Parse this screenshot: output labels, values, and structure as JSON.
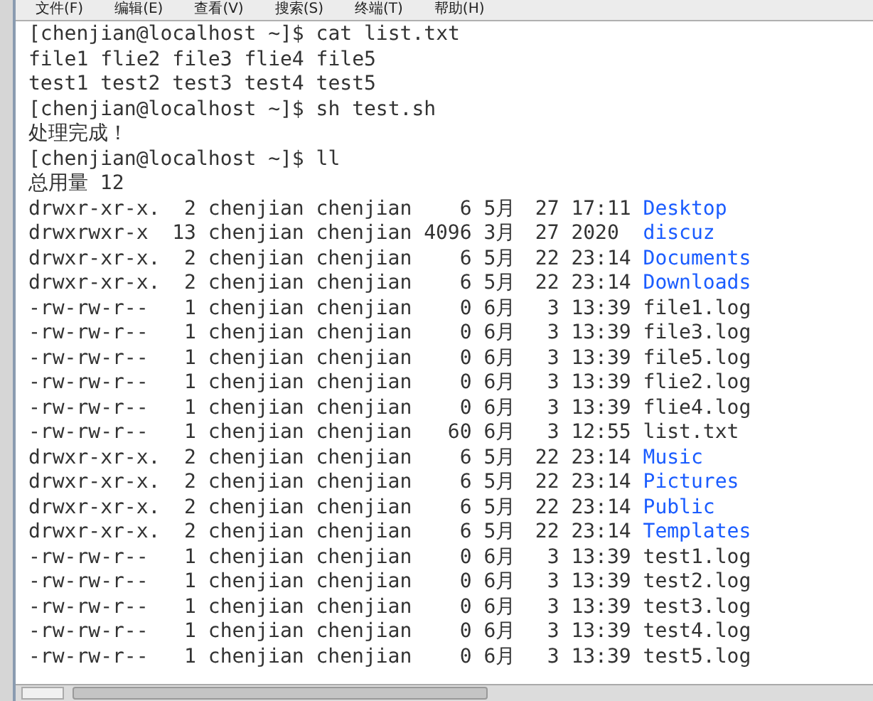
{
  "menu": [
    "文件(F)",
    "编辑(E)",
    "查看(V)",
    "搜索(S)",
    "终端(T)",
    "帮助(H)"
  ],
  "lines": [
    "[chenjian@localhost ~]$ cat list.txt",
    "file1 flie2 file3 flie4 file5",
    "test1 test2 test3 test4 test5",
    "[chenjian@localhost ~]$ sh test.sh",
    "处理完成！",
    "[chenjian@localhost ~]$ ll",
    "总用量 12"
  ],
  "listing": [
    {
      "perms": "drwxr-xr-x.",
      "links": "2",
      "owner": "chenjian",
      "group": "chenjian",
      "size": "6",
      "month": "5月",
      "day": "27",
      "time": "17:11",
      "name": "Desktop",
      "color": "#1a5cff"
    },
    {
      "perms": "drwxrwxr-x",
      "links": "13",
      "owner": "chenjian",
      "group": "chenjian",
      "size": "4096",
      "month": "3月",
      "day": "27",
      "time": "2020",
      "name": "discuz",
      "color": "#1a5cff"
    },
    {
      "perms": "drwxr-xr-x.",
      "links": "2",
      "owner": "chenjian",
      "group": "chenjian",
      "size": "6",
      "month": "5月",
      "day": "22",
      "time": "23:14",
      "name": "Documents",
      "color": "#1a5cff"
    },
    {
      "perms": "drwxr-xr-x.",
      "links": "2",
      "owner": "chenjian",
      "group": "chenjian",
      "size": "6",
      "month": "5月",
      "day": "22",
      "time": "23:14",
      "name": "Downloads",
      "color": "#1a5cff"
    },
    {
      "perms": "-rw-rw-r--",
      "links": "1",
      "owner": "chenjian",
      "group": "chenjian",
      "size": "0",
      "month": "6月",
      "day": "3",
      "time": "13:39",
      "name": "file1.log",
      "color": "#333333"
    },
    {
      "perms": "-rw-rw-r--",
      "links": "1",
      "owner": "chenjian",
      "group": "chenjian",
      "size": "0",
      "month": "6月",
      "day": "3",
      "time": "13:39",
      "name": "file3.log",
      "color": "#333333"
    },
    {
      "perms": "-rw-rw-r--",
      "links": "1",
      "owner": "chenjian",
      "group": "chenjian",
      "size": "0",
      "month": "6月",
      "day": "3",
      "time": "13:39",
      "name": "file5.log",
      "color": "#333333"
    },
    {
      "perms": "-rw-rw-r--",
      "links": "1",
      "owner": "chenjian",
      "group": "chenjian",
      "size": "0",
      "month": "6月",
      "day": "3",
      "time": "13:39",
      "name": "flie2.log",
      "color": "#333333"
    },
    {
      "perms": "-rw-rw-r--",
      "links": "1",
      "owner": "chenjian",
      "group": "chenjian",
      "size": "0",
      "month": "6月",
      "day": "3",
      "time": "13:39",
      "name": "flie4.log",
      "color": "#333333"
    },
    {
      "perms": "-rw-rw-r--",
      "links": "1",
      "owner": "chenjian",
      "group": "chenjian",
      "size": "60",
      "month": "6月",
      "day": "3",
      "time": "12:55",
      "name": "list.txt",
      "color": "#333333"
    },
    {
      "perms": "drwxr-xr-x.",
      "links": "2",
      "owner": "chenjian",
      "group": "chenjian",
      "size": "6",
      "month": "5月",
      "day": "22",
      "time": "23:14",
      "name": "Music",
      "color": "#1a5cff"
    },
    {
      "perms": "drwxr-xr-x.",
      "links": "2",
      "owner": "chenjian",
      "group": "chenjian",
      "size": "6",
      "month": "5月",
      "day": "22",
      "time": "23:14",
      "name": "Pictures",
      "color": "#1a5cff"
    },
    {
      "perms": "drwxr-xr-x.",
      "links": "2",
      "owner": "chenjian",
      "group": "chenjian",
      "size": "6",
      "month": "5月",
      "day": "22",
      "time": "23:14",
      "name": "Public",
      "color": "#1a5cff"
    },
    {
      "perms": "drwxr-xr-x.",
      "links": "2",
      "owner": "chenjian",
      "group": "chenjian",
      "size": "6",
      "month": "5月",
      "day": "22",
      "time": "23:14",
      "name": "Templates",
      "color": "#1a5cff"
    },
    {
      "perms": "-rw-rw-r--",
      "links": "1",
      "owner": "chenjian",
      "group": "chenjian",
      "size": "0",
      "month": "6月",
      "day": "3",
      "time": "13:39",
      "name": "test1.log",
      "color": "#333333"
    },
    {
      "perms": "-rw-rw-r--",
      "links": "1",
      "owner": "chenjian",
      "group": "chenjian",
      "size": "0",
      "month": "6月",
      "day": "3",
      "time": "13:39",
      "name": "test2.log",
      "color": "#333333"
    },
    {
      "perms": "-rw-rw-r--",
      "links": "1",
      "owner": "chenjian",
      "group": "chenjian",
      "size": "0",
      "month": "6月",
      "day": "3",
      "time": "13:39",
      "name": "test3.log",
      "color": "#333333"
    },
    {
      "perms": "-rw-rw-r--",
      "links": "1",
      "owner": "chenjian",
      "group": "chenjian",
      "size": "0",
      "month": "6月",
      "day": "3",
      "time": "13:39",
      "name": "test4.log",
      "color": "#333333"
    },
    {
      "perms": "-rw-rw-r--",
      "links": "1",
      "owner": "chenjian",
      "group": "chenjian",
      "size": "0",
      "month": "6月",
      "day": "3",
      "time": "13:39",
      "name": "test5.log",
      "color": "#333333"
    }
  ]
}
